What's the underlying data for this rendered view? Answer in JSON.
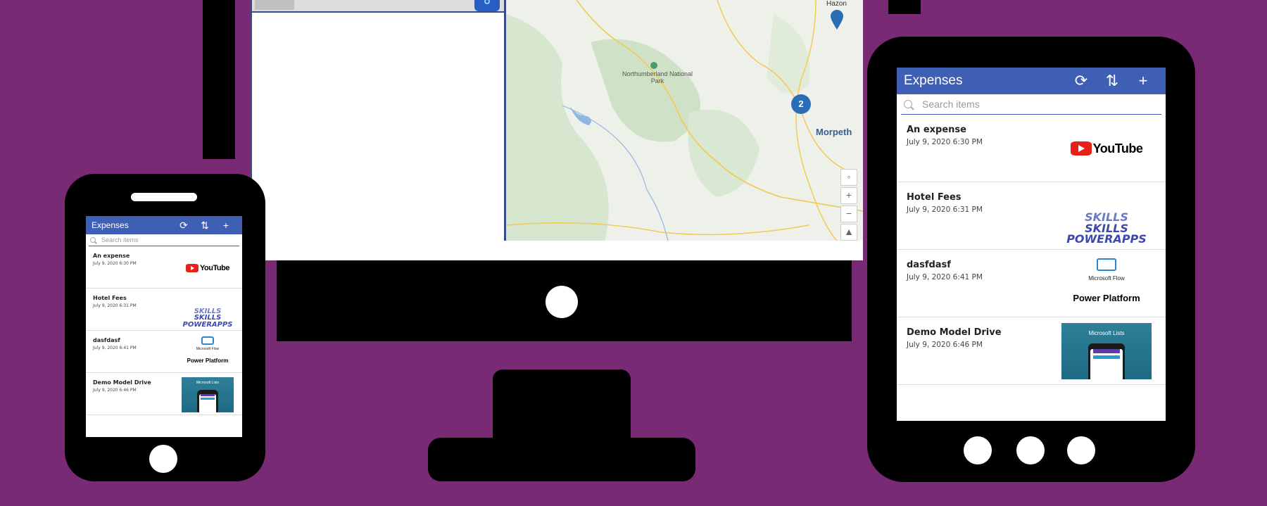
{
  "app": {
    "title": "Expenses",
    "search_placeholder": "Search items",
    "icons": [
      "refresh-icon",
      "sort-icon",
      "add-icon"
    ],
    "items": [
      {
        "title": "An expense",
        "date": "July 9, 2020 6:30 PM",
        "thumb": "youtube"
      },
      {
        "title": "Hotel Fees",
        "date": "July 9, 2020 6:31 PM",
        "thumb": "skills-powerapps"
      },
      {
        "title": "dasfdasf",
        "date": "July 9, 2020 6:41 PM",
        "thumb": "microsoft-flow"
      },
      {
        "title": "Demo Model Drive",
        "date": "July 9, 2020 6:46 PM",
        "thumb": "microsoft-lists"
      }
    ]
  },
  "thumbs": {
    "youtube": "YouTube",
    "skills_small": "SKILLS",
    "skills_big": "SKILLS",
    "powerapps": "POWERAPPS",
    "flow_sub": "Microsoft Flow",
    "flow_big": "Power Platform",
    "lists_title": "Microsoft Lists"
  },
  "map": {
    "park_label": "Northumberland National Park",
    "town": "Morpeth",
    "place": "Hazon",
    "cluster_count": "2",
    "controls": [
      "+",
      "−"
    ]
  },
  "colors": {
    "background": "#792a75",
    "app_header": "#3f5fb5"
  }
}
